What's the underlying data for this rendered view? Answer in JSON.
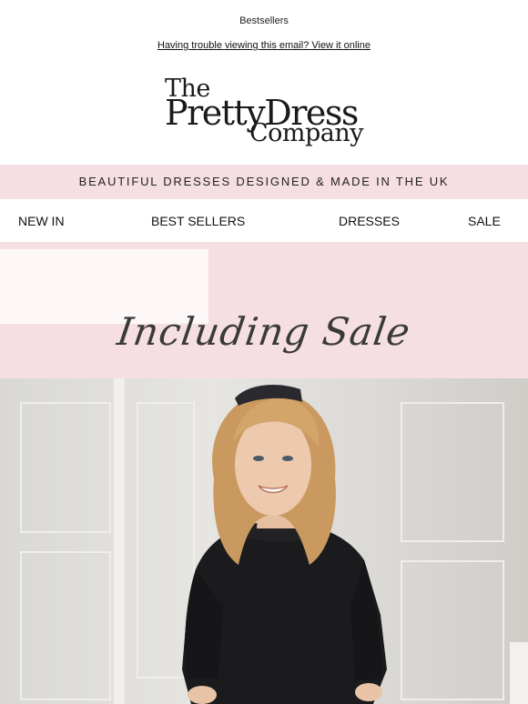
{
  "preheader": {
    "text": "Bestsellers",
    "view_online": "Having trouble viewing this email? View it online"
  },
  "logo": {
    "line1": "The",
    "line2": "PrettyDress",
    "line3": "Company"
  },
  "banner": {
    "text": "BEAUTIFUL DRESSES DESIGNED & MADE IN THE UK"
  },
  "nav": {
    "items": [
      {
        "label": "NEW IN"
      },
      {
        "label": "BEST SELLERS"
      },
      {
        "label": "DRESSES"
      },
      {
        "label": "SALE"
      }
    ]
  },
  "hero": {
    "script_text": "Including Sale"
  },
  "colors": {
    "pink_band": "#f6dfe3",
    "text": "#111111"
  }
}
